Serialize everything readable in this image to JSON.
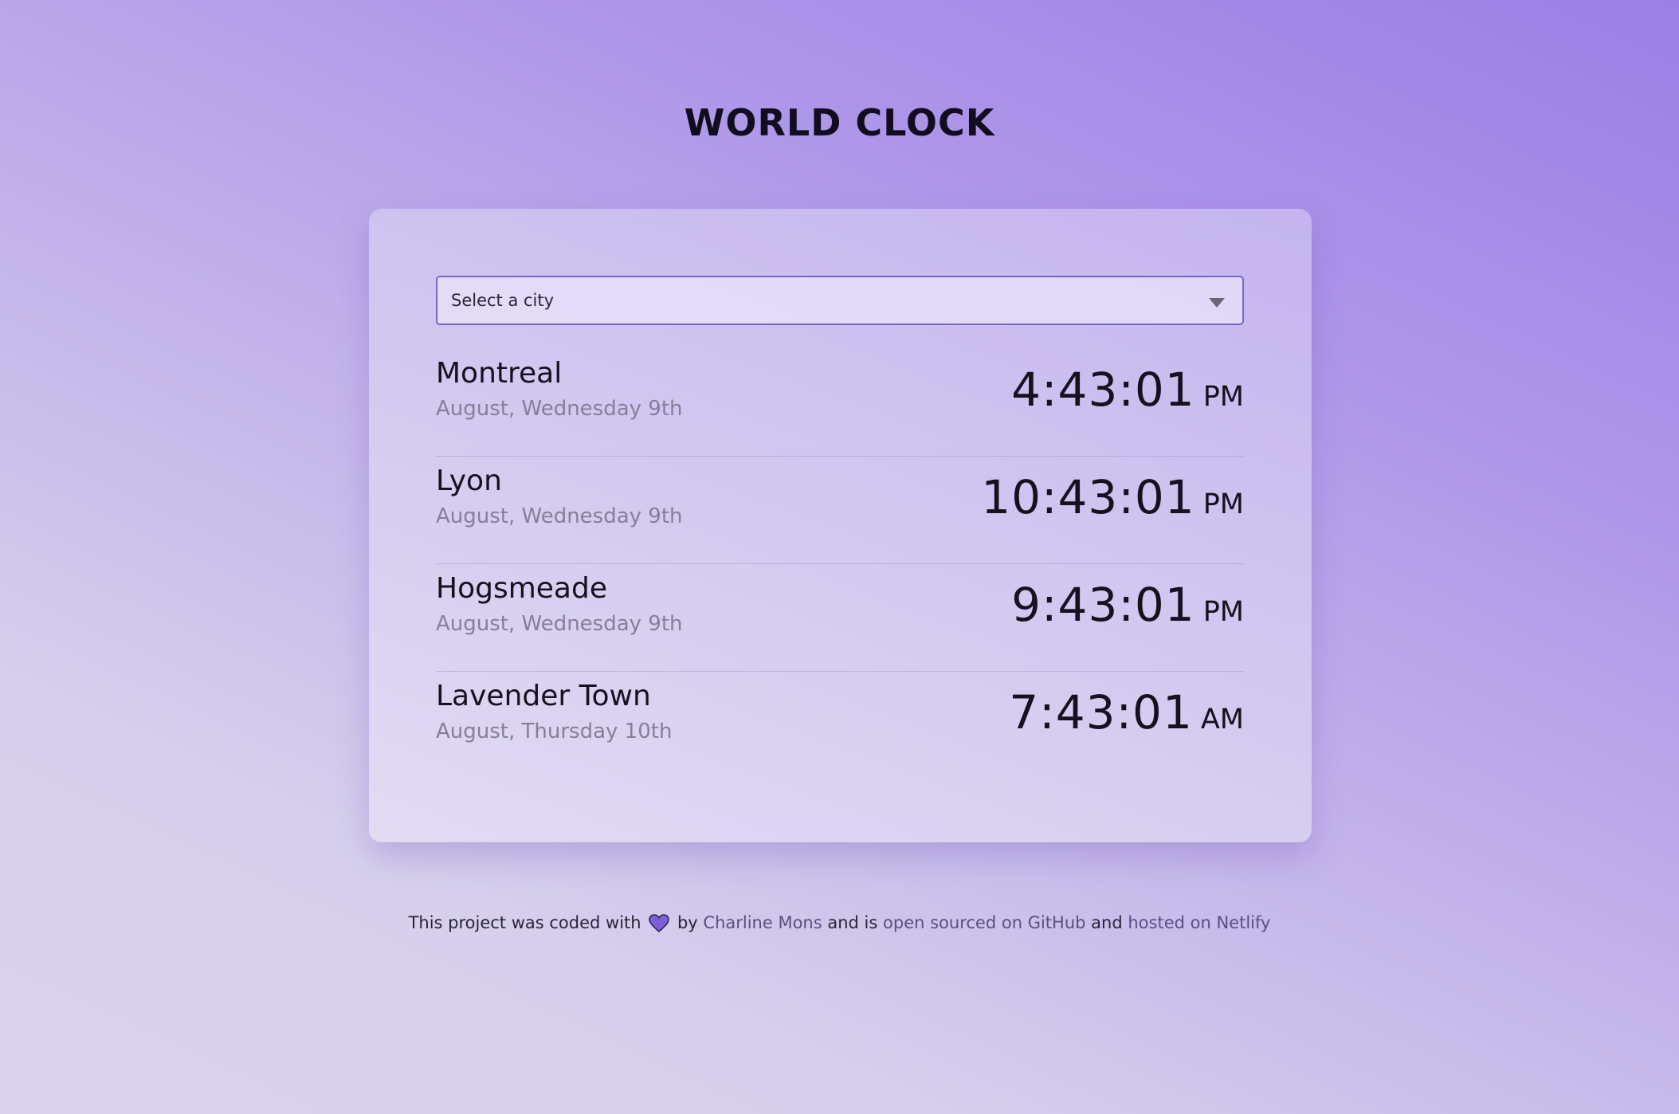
{
  "app": {
    "title": "WORLD CLOCK"
  },
  "select": {
    "label": "Select a city"
  },
  "cities": [
    {
      "name": "Montreal",
      "date": "August, Wednesday 9th",
      "time": "4:43:01",
      "ampm": "PM"
    },
    {
      "name": "Lyon",
      "date": "August, Wednesday 9th",
      "time": "10:43:01",
      "ampm": "PM"
    },
    {
      "name": "Hogsmeade",
      "date": "August, Wednesday 9th",
      "time": "9:43:01",
      "ampm": "PM"
    },
    {
      "name": "Lavender Town",
      "date": "August, Thursday 10th",
      "time": "7:43:01",
      "ampm": "AM"
    }
  ],
  "footer": {
    "text_before_heart": "This project was coded with",
    "text_by": "by",
    "author_link": "Charline Mons",
    "text_and_is": "and is",
    "github_link": "open sourced on GitHub",
    "text_and": "and",
    "netlify_link": "hosted on Netlify",
    "heart_icon": "heart-icon"
  },
  "colors": {
    "accent": "#7a63c4",
    "heart": "#7b5fd6",
    "link": "#5a4f80"
  }
}
